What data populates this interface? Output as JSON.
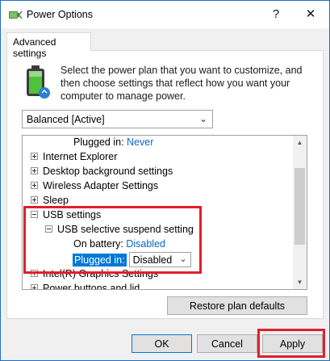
{
  "window": {
    "title": "Power Options",
    "help_glyph": "?",
    "close_glyph": "✕"
  },
  "tabs": [
    {
      "label": "Advanced settings"
    }
  ],
  "description": "Select the power plan that you want to customize, and then choose settings that reflect how you want your computer to manage power.",
  "plan_select": {
    "value": "Balanced [Active]"
  },
  "settings_tree": {
    "top_child": {
      "label": "Plugged in:",
      "value": "Never"
    },
    "items": [
      {
        "label": "Internet Explorer",
        "expanded": false
      },
      {
        "label": "Desktop background settings",
        "expanded": false
      },
      {
        "label": "Wireless Adapter Settings",
        "expanded": false
      },
      {
        "label": "Sleep",
        "expanded": false
      },
      {
        "label": "USB settings",
        "expanded": true
      }
    ],
    "usb": {
      "child_label": "USB selective suspend setting",
      "on_battery_label": "On battery:",
      "on_battery_value": "Disabled",
      "plugged_in_label": "Plugged in:",
      "plugged_in_value": "Disabled"
    },
    "partial_items": [
      {
        "label": "Intel(R) Graphics Settings"
      },
      {
        "label": "Power buttons and lid"
      }
    ]
  },
  "buttons": {
    "restore": "Restore plan defaults",
    "ok": "OK",
    "cancel": "Cancel",
    "apply": "Apply"
  },
  "icons": {
    "app": "power-plug-icon",
    "battery": "battery-icon",
    "expand": "plus-box-icon",
    "collapse": "minus-box-icon",
    "dropdown": "chevron-down-icon"
  },
  "colors": {
    "accent": "#0078d7",
    "link": "#0d64c8",
    "highlight_annotation": "#e0202d"
  }
}
